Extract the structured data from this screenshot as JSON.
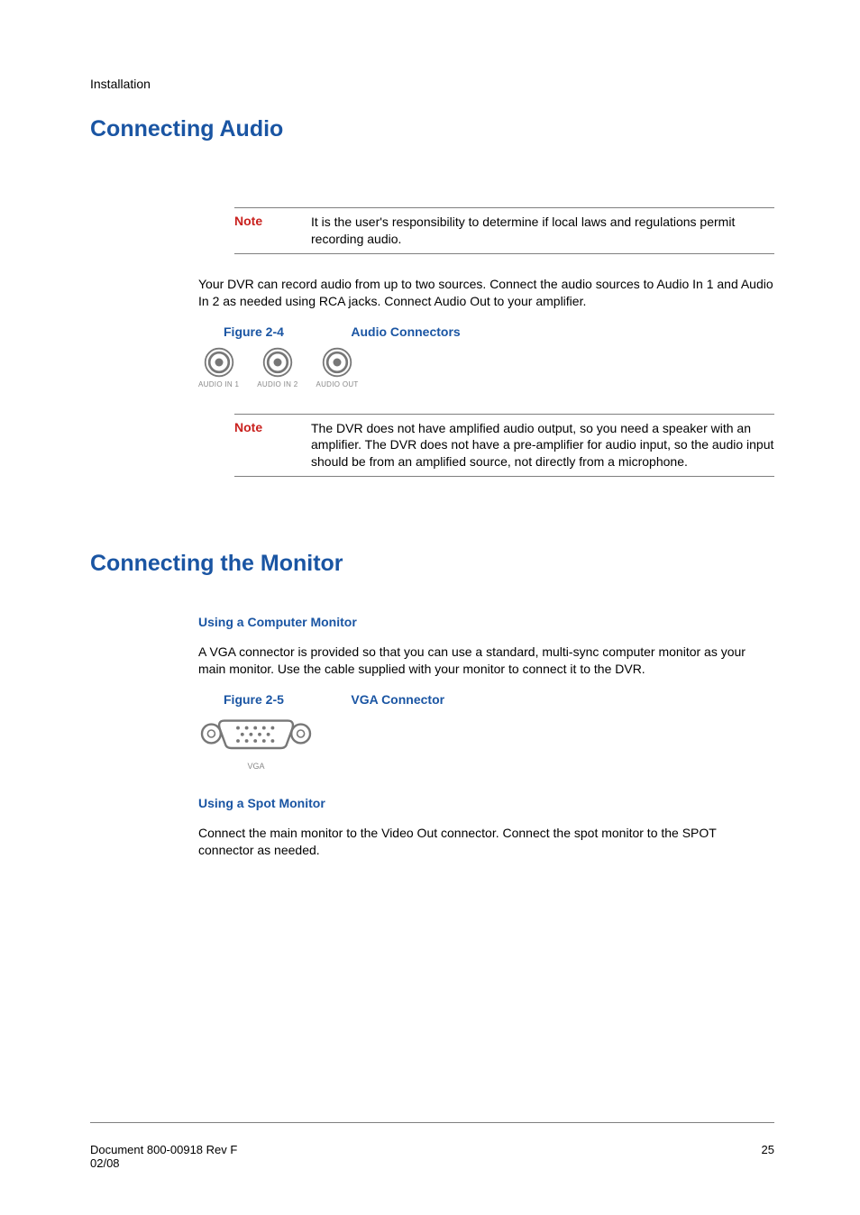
{
  "chapter": "Installation",
  "h1a": "Connecting Audio",
  "note1": {
    "label": "Note",
    "body": "It is the user's responsibility to determine if local laws and regulations permit recording audio."
  },
  "para1": "Your DVR can record audio from up to two sources. Connect the audio sources to Audio In 1 and Audio In 2 as needed using RCA jacks. Connect Audio Out to your amplifier.",
  "fig24": {
    "num": "Figure 2-4",
    "title": "Audio Connectors"
  },
  "audio_labels": {
    "in1": "AUDIO IN 1",
    "in2": "AUDIO IN 2",
    "out": "AUDIO OUT"
  },
  "note2": {
    "label": "Note",
    "body": "The DVR does not have amplified audio output, so you need a speaker with an amplifier. The DVR does not have a pre-amplifier for audio input, so the audio input should be from an amplified source, not directly from a microphone."
  },
  "h1b": "Connecting the Monitor",
  "h3a": "Using a Computer Monitor",
  "para2": "A VGA connector is provided so that you can use a standard, multi-sync computer monitor as your main monitor. Use the cable supplied with your monitor to connect it to the DVR.",
  "fig25": {
    "num": "Figure 2-5",
    "title": "VGA Connector"
  },
  "vga_label": "VGA",
  "h3b": "Using a Spot Monitor",
  "para3": "Connect the main monitor to the Video Out connector. Connect the spot monitor to the SPOT connector as needed.",
  "footer": {
    "docrev": "Document 800-00918 Rev F",
    "date": "02/08",
    "page": "25"
  }
}
